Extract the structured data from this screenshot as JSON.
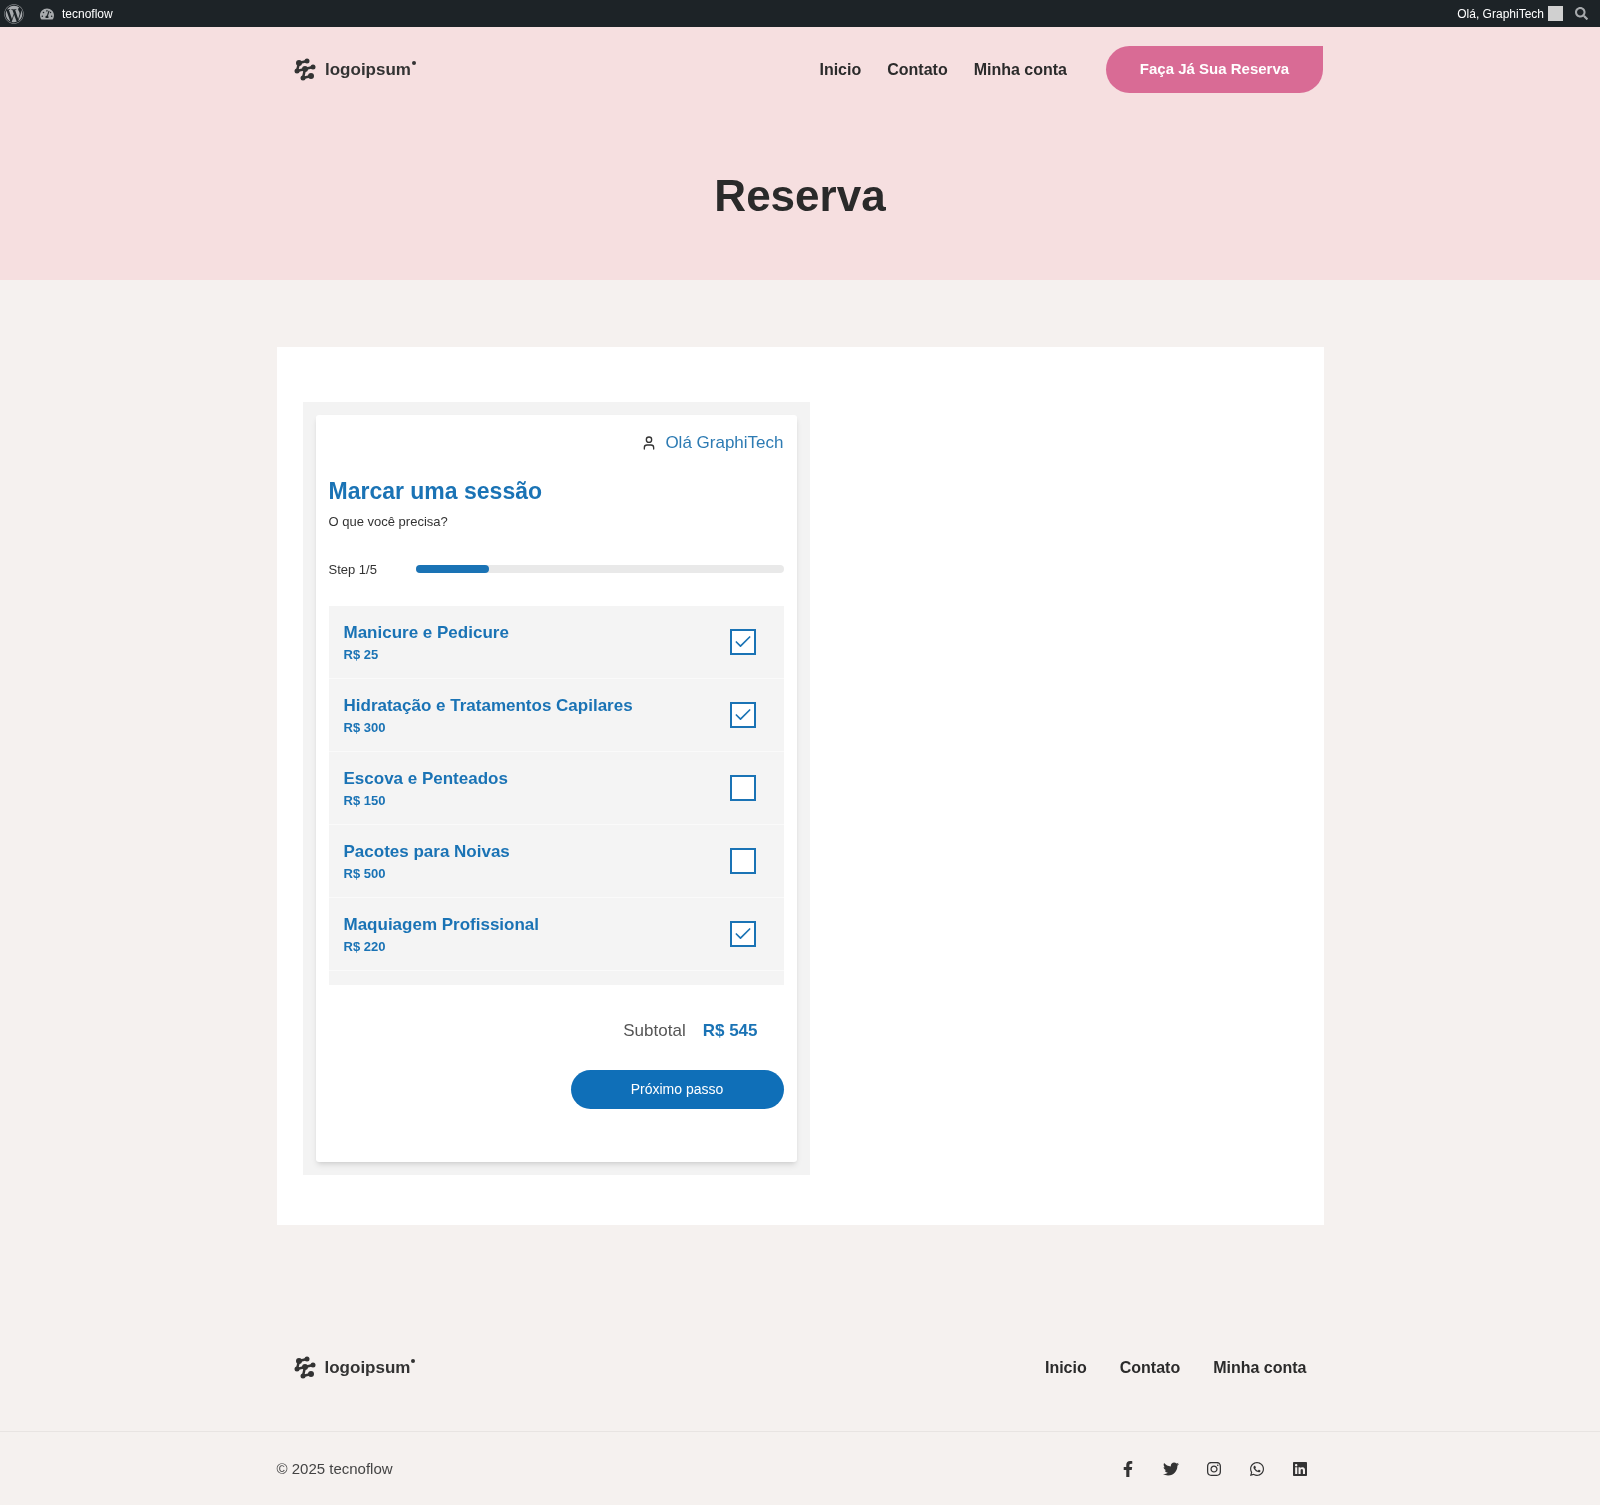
{
  "admin_bar": {
    "site": "tecnoflow",
    "greeting": "Olá, GraphiTech"
  },
  "header": {
    "logo": "logoipsum",
    "nav": [
      "Inicio",
      "Contato",
      "Minha conta"
    ],
    "cta": "Faça Já Sua Reserva"
  },
  "hero": {
    "title": "Reserva"
  },
  "booking": {
    "user": "Olá GraphiTech",
    "title": "Marcar uma sessão",
    "subtitle": "O que você precisa?",
    "step": "Step 1/5",
    "level": 0.2,
    "services": [
      {
        "name": "Manicure e Pedicure",
        "price": "R$ 25",
        "checked": true
      },
      {
        "name": "Hidratação e Tratamentos Capilares",
        "price": "R$ 300",
        "checked": true
      },
      {
        "name": "Escova e Penteados",
        "price": "R$ 150",
        "checked": false
      },
      {
        "name": "Pacotes para Noivas",
        "price": "R$ 500",
        "checked": false
      },
      {
        "name": "Maquiagem Profissional",
        "price": "R$ 220",
        "checked": true
      }
    ],
    "subtotal_label": "Subtotal",
    "subtotal": "R$ 545",
    "next": "Próximo passo"
  },
  "footer": {
    "logo": "logoipsum",
    "nav": [
      "Inicio",
      "Contato",
      "Minha conta"
    ],
    "copyright": "© 2025 tecnoflow"
  }
}
